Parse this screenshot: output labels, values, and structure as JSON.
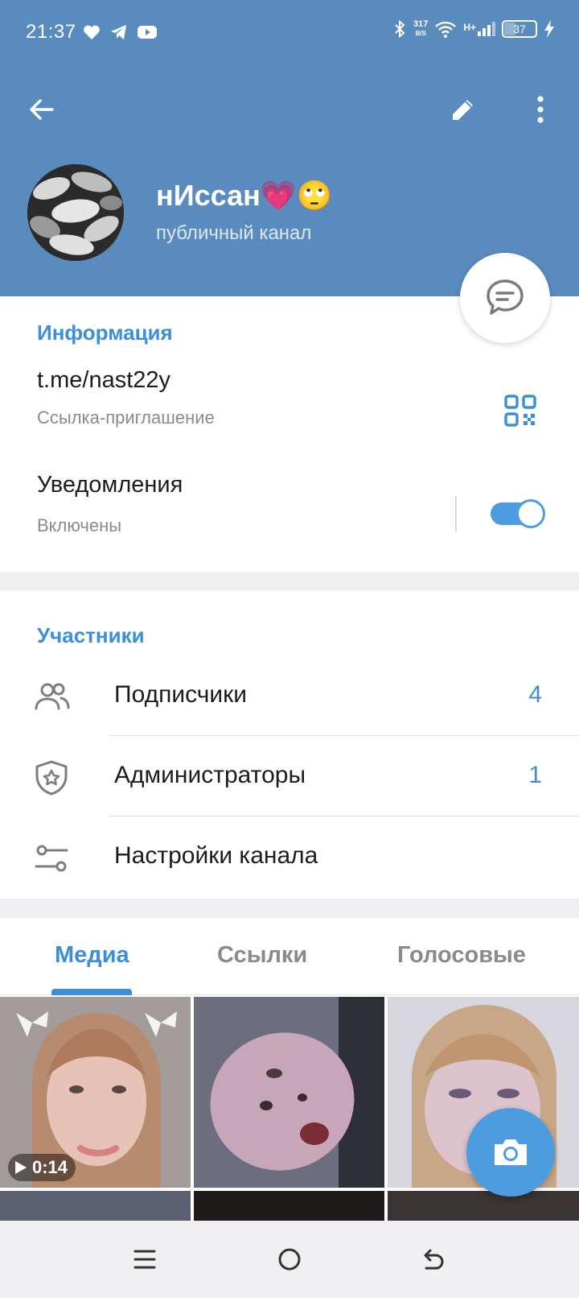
{
  "status_bar": {
    "time": "21:37",
    "net_speed_value": "317",
    "net_speed_unit": "B/S",
    "network_type": "H+",
    "battery": "37",
    "battery_level": 0.37
  },
  "channel": {
    "name": "нИссан💗🙄",
    "subtitle": "публичный канал"
  },
  "info": {
    "section_title": "Информация",
    "link": "t.me/nast22y",
    "link_caption": "Ссылка-приглашение",
    "notifications_label": "Уведомления",
    "notifications_state": "Включены",
    "notifications_on": true
  },
  "members": {
    "section_title": "Участники",
    "rows": [
      {
        "label": "Подписчики",
        "count": "4",
        "icon": "people-icon"
      },
      {
        "label": "Администраторы",
        "count": "1",
        "icon": "shield-star-icon"
      },
      {
        "label": "Настройки канала",
        "count": "",
        "icon": "sliders-icon"
      }
    ]
  },
  "media": {
    "tabs": [
      "Медиа",
      "Ссылки",
      "Голосовые"
    ],
    "active_tab": 0,
    "video_duration": "0:14"
  },
  "colors": {
    "header": "#5a8bbf",
    "accent": "#3a8fd8",
    "fab": "#4e9ce0"
  }
}
